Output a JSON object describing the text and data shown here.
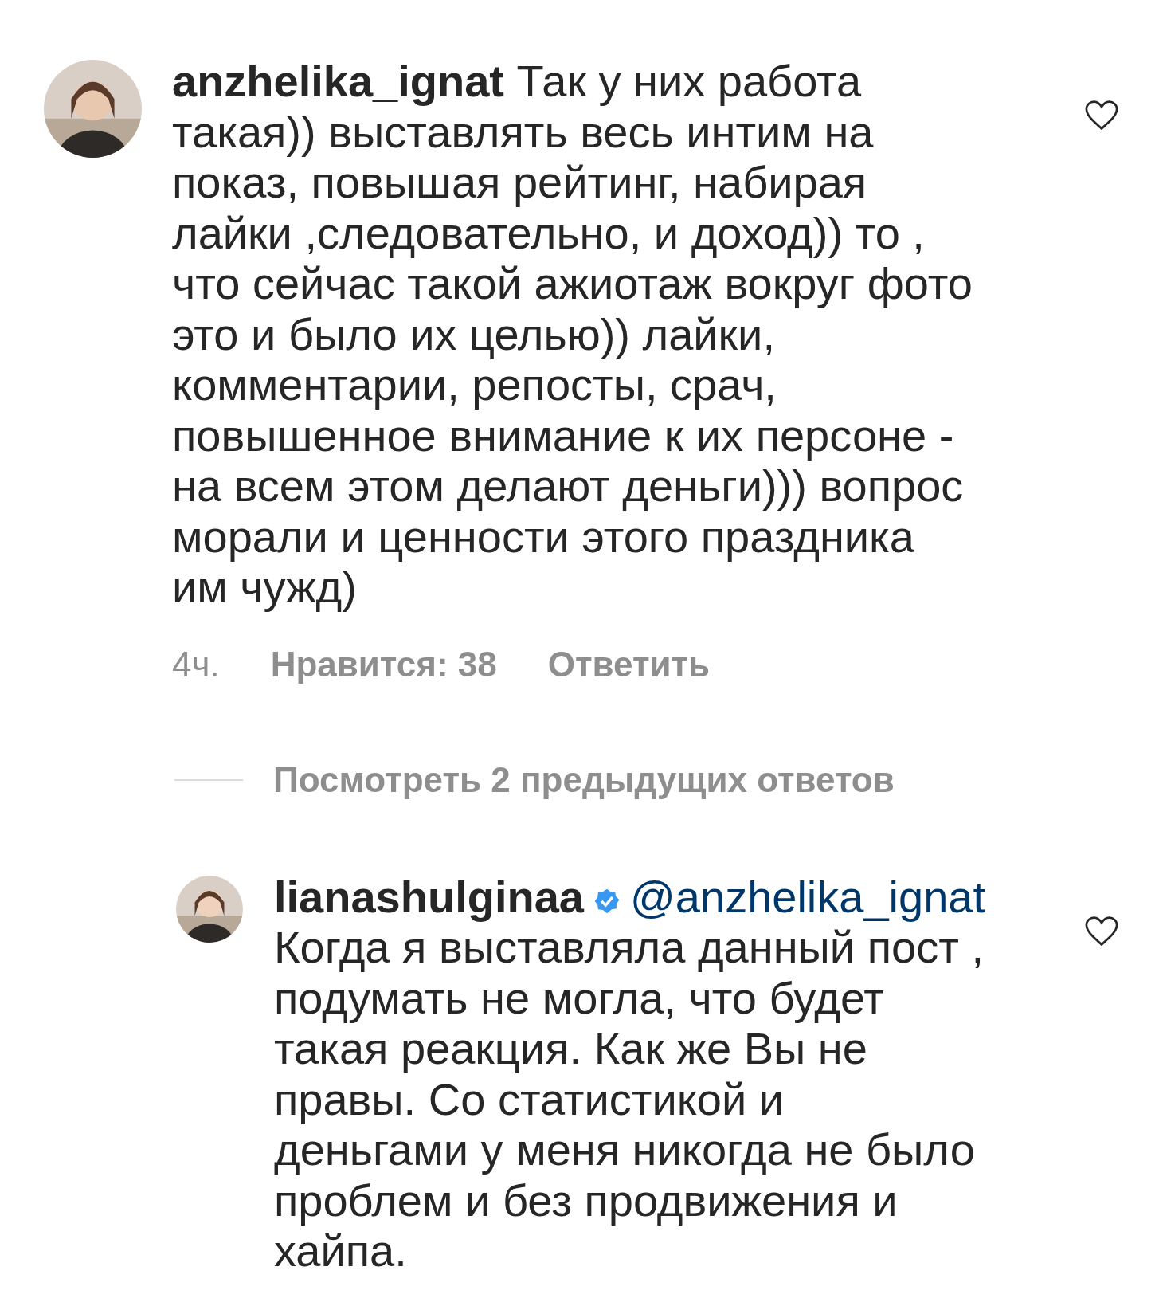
{
  "comment": {
    "username": "anzhelika_ignat",
    "verified": false,
    "text": "Так у них работа\nтакая)) выставлять весь интим на\nпоказ, повышая рейтинг, набирая\nлайки ,следовательно, и доход)) то ,\nчто сейчас такой ажиотаж вокруг фото\nэто и было их целью)) лайки,\nкомментарии, репосты, срач,\nповышенное внимание к их персоне -\nна всем этом делают деньги))) вопрос\nморали и ценности этого праздника\nим чужд)",
    "time": "4ч.",
    "likes": "Нравится: 38",
    "reply_action": "Ответить"
  },
  "view_replies": "Посмотреть 2 предыдущих ответов",
  "reply": {
    "username": "lianashulginaa",
    "verified": true,
    "mention": "@anzhelika_ignat",
    "text": "Когда я выставляла данный пост ,\nподумать не могла, что будет\nтакая реакция. Как же Вы не\nправы. Со статистикой и\nденьгами у меня никогда не было\nпроблем и без продвижения и\nхайпа."
  }
}
